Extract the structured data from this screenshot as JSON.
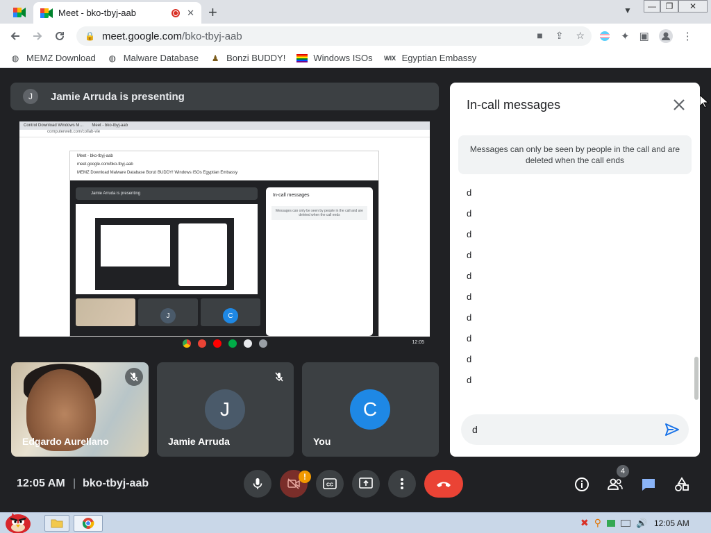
{
  "browser": {
    "tab_title": "Meet - bko-tbyj-aab",
    "url_host": "meet.google.com",
    "url_path": "/bko-tbyj-aab",
    "bookmarks": [
      {
        "label": "MEMZ Download"
      },
      {
        "label": "Malware Database"
      },
      {
        "label": "Bonzi BUDDY!"
      },
      {
        "label": "Windows ISOs"
      },
      {
        "label": "Egyptian Embassy"
      }
    ]
  },
  "meet": {
    "presenter_initial": "J",
    "presenting_text": "Jamie Arruda is presenting",
    "tiles": [
      {
        "name": "Edgardo Aurellano"
      },
      {
        "name": "Jamie Arruda",
        "initial": "J"
      },
      {
        "name": "You",
        "initial": "C"
      }
    ],
    "time": "12:05 AM",
    "separator": "|",
    "meeting_code": "bko-tbyj-aab",
    "camera_warning": "!",
    "people_count": "4"
  },
  "nested_screen": {
    "tab1": "Control Download Windows M…",
    "tab2": "Meet - bko-tbyj-aab",
    "address": "computerweb.com/collab-vie",
    "inner_tab": "Meet - bko-tbyj-aab",
    "inner_address": "meet.google.com/bko-tbyj-aab",
    "inner_bookmarks": "MEMZ Download   Malware Database   Bonzi BUDDY!   Windows ISOs   Egyptian Embassy",
    "presenting_text": "Jamie Arruda is presenting",
    "panel_title": "In-call messages",
    "panel_note": "Messages can only be seen by people in the call and are deleted when the call ends",
    "tile_initials": [
      "J",
      "C"
    ],
    "clock": "12:05"
  },
  "chat": {
    "title": "In-call messages",
    "note": "Messages can only be seen by people in the call and are deleted when the call ends",
    "messages": [
      "d",
      "d",
      "d",
      "d",
      "d",
      "d",
      "d",
      "d",
      "d",
      "d"
    ],
    "input_value": "d"
  },
  "taskbar": {
    "time": "12:05 AM"
  },
  "colors": {
    "meet_bg": "#202124",
    "tile_bg": "#3c4043",
    "accent_blue": "#1a73e8",
    "end_call_red": "#ea4335",
    "you_avatar": "#1e88e5",
    "jamie_avatar": "#4a5a6a"
  }
}
